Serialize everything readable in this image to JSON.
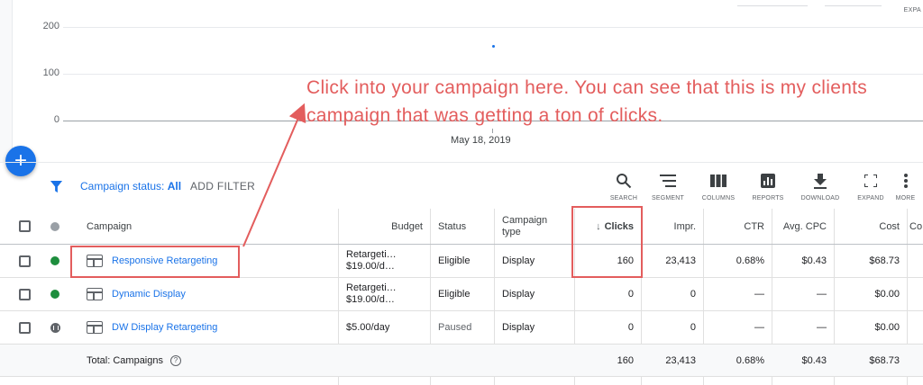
{
  "chart": {
    "y_ticks": [
      "200",
      "100",
      "0"
    ],
    "x_label": "May 18, 2019",
    "expand_label": "EXPA"
  },
  "chart_data": {
    "type": "scatter",
    "x": [
      "May 18, 2019"
    ],
    "y": [
      160
    ],
    "ylim": [
      0,
      250
    ]
  },
  "fab": {
    "label": "+"
  },
  "filter": {
    "status_label": "Campaign status:",
    "status_value": "All",
    "add_filter": "ADD FILTER"
  },
  "toolbar": {
    "search": "SEARCH",
    "segment": "SEGMENT",
    "columns": "COLUMNS",
    "reports": "REPORTS",
    "download": "DOWNLOAD",
    "expand": "EXPAND",
    "more": "MORE"
  },
  "table": {
    "headers": {
      "campaign": "Campaign",
      "budget": "Budget",
      "status": "Status",
      "campaign_type": "Campaign type",
      "clicks": "Clicks",
      "impr": "Impr.",
      "ctr": "CTR",
      "avg_cpc": "Avg. CPC",
      "cost": "Cost",
      "conv": "Co"
    },
    "rows": [
      {
        "name": "Responsive Retargeting",
        "budget_line1": "Retargeti…",
        "budget_line2": "$19.00/d…",
        "status": "Eligible",
        "type": "Display",
        "clicks": "160",
        "impr": "23,413",
        "ctr": "0.68%",
        "avg_cpc": "$0.43",
        "cost": "$68.73"
      },
      {
        "name": "Dynamic Display",
        "budget_line1": "Retargeti…",
        "budget_line2": "$19.00/d…",
        "status": "Eligible",
        "type": "Display",
        "clicks": "0",
        "impr": "0",
        "ctr": "—",
        "avg_cpc": "—",
        "cost": "$0.00"
      },
      {
        "name": "DW Display Retargeting",
        "budget": "$5.00/day",
        "status": "Paused",
        "type": "Display",
        "clicks": "0",
        "impr": "0",
        "ctr": "—",
        "avg_cpc": "—",
        "cost": "$0.00"
      }
    ],
    "total": {
      "label": "Total: Campaigns",
      "help": "?",
      "clicks": "160",
      "impr": "23,413",
      "ctr": "0.68%",
      "avg_cpc": "$0.43",
      "cost": "$68.73"
    }
  },
  "annotation": {
    "text": "Click into your campaign here. You can see that this is my clients campaign that was getting a ton of clicks.",
    "color": "#e35d5d"
  },
  "colors": {
    "accent": "#1a73e8",
    "enabled": "#1e8e3e",
    "annotation": "#e35d5d"
  }
}
